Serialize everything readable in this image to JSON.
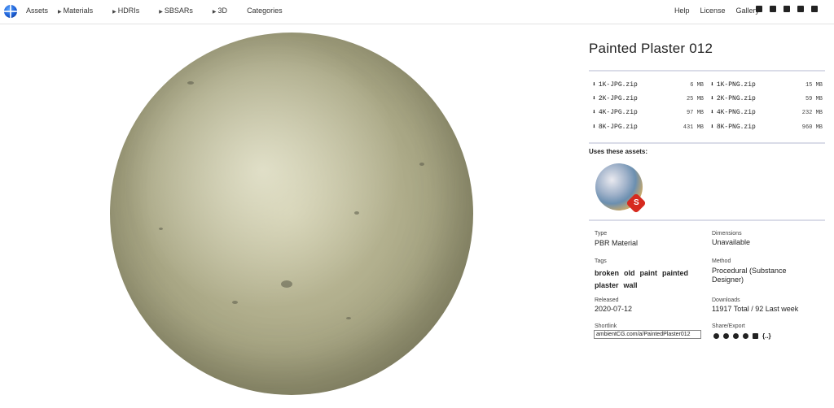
{
  "nav": {
    "logo": "ambientCG-logo",
    "items": [
      {
        "label": "Assets"
      },
      {
        "label": "Materials",
        "arrow": true
      },
      {
        "label": "HDRIs",
        "arrow": true
      },
      {
        "label": "SBSARs",
        "arrow": true
      },
      {
        "label": "3D",
        "arrow": true
      },
      {
        "label": "Categories"
      }
    ],
    "right_items": [
      "Help",
      "License",
      "Gallery"
    ],
    "social_icons": [
      "kofi-icon",
      "patreon-icon",
      "sketchfab-icon",
      "twitter-icon",
      "instagram-icon"
    ]
  },
  "asset": {
    "title": "Painted Plaster 012",
    "downloads": [
      {
        "label": "1K-JPG.zip",
        "size": "6 MB"
      },
      {
        "label": "1K-PNG.zip",
        "size": "15 MB"
      },
      {
        "label": "2K-JPG.zip",
        "size": "25 MB"
      },
      {
        "label": "2K-PNG.zip",
        "size": "59 MB"
      },
      {
        "label": "4K-JPG.zip",
        "size": "97 MB"
      },
      {
        "label": "4K-PNG.zip",
        "size": "232 MB"
      },
      {
        "label": "8K-JPG.zip",
        "size": "431 MB"
      },
      {
        "label": "8K-PNG.zip",
        "size": "960 MB"
      }
    ],
    "uses_label": "Uses these assets:",
    "badge_letter": "S",
    "info": {
      "type_label": "Type",
      "type_value": "PBR Material",
      "dimensions_label": "Dimensions",
      "dimensions_value": "Unavailable",
      "tags_label": "Tags",
      "tags": [
        "broken",
        "old",
        "paint",
        "painted",
        "plaster",
        "wall"
      ],
      "method_label": "Method",
      "method_value": "Procedural (Substance Designer)",
      "released_label": "Released",
      "released_value": "2020-07-12",
      "downloads_label": "Downloads",
      "downloads_value": "11917 Total / 92 Last week",
      "shortlink_label": "Shortlink",
      "shortlink_value": "ambientCG.com/a/PaintedPlaster012",
      "share_label": "Share/Export",
      "share_icons": [
        "twitter-icon",
        "reddit-icon",
        "facebook-icon",
        "pinterest-icon",
        "file-icon",
        "json-icon"
      ],
      "json_glyph": "{..}"
    }
  }
}
